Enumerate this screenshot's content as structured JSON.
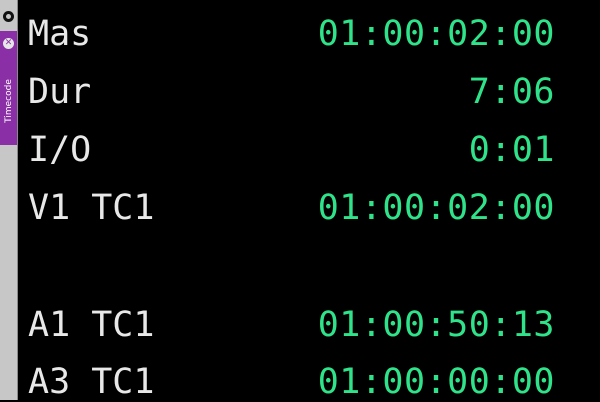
{
  "panel": {
    "tab_label": "Timecode",
    "colors": {
      "background": "#000000",
      "label": "#e8e8e8",
      "value": "#2fe38a",
      "tab_accent": "#8b2fa6"
    }
  },
  "rows": [
    {
      "label": "Mas",
      "value": "01:00:02:00"
    },
    {
      "label": "Dur",
      "value": "7:06"
    },
    {
      "label": "I/O",
      "value": "0:01"
    },
    {
      "label": "V1 TC1",
      "value": "01:00:02:00"
    },
    {
      "label": "A1 TC1",
      "value": "01:00:50:13"
    },
    {
      "label": "A3 TC1",
      "value": "01:00:00:00"
    }
  ]
}
